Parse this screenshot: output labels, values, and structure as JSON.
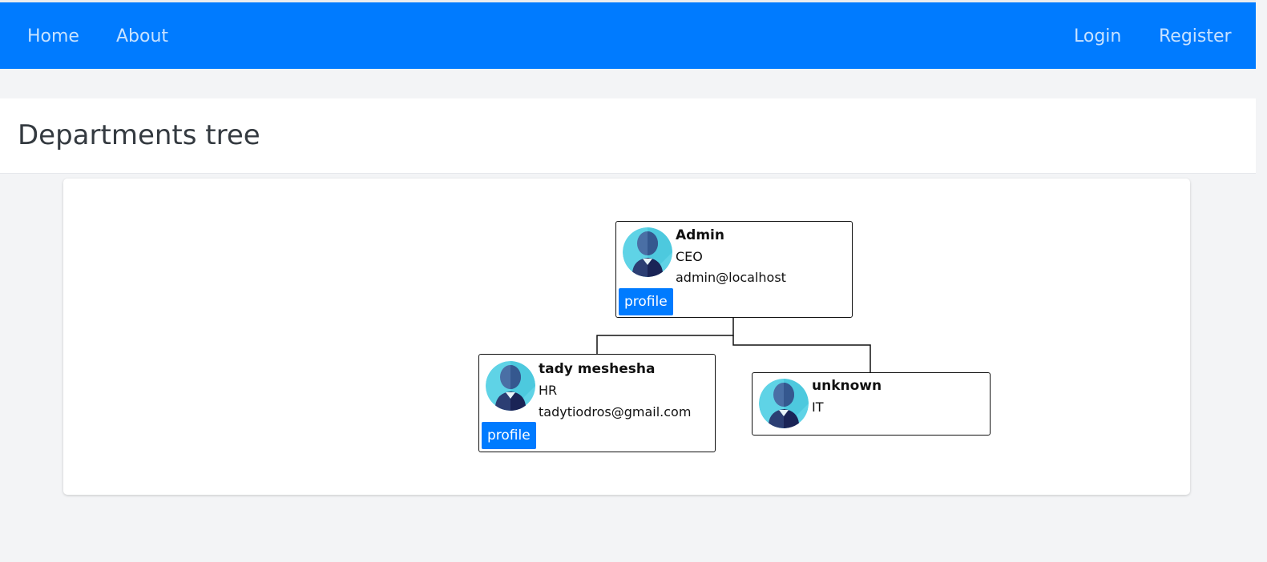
{
  "nav": {
    "home": "Home",
    "about": "About",
    "login": "Login",
    "register": "Register"
  },
  "page": {
    "title": "Departments tree"
  },
  "tree": {
    "root": {
      "name": "Admin",
      "role": "CEO",
      "email": "admin@localhost",
      "button": "profile"
    },
    "children": [
      {
        "name": "tady meshesha",
        "role": "HR",
        "email": "tadytiodros@gmail.com",
        "button": "profile"
      },
      {
        "name": "unknown",
        "role": "IT"
      }
    ]
  },
  "colors": {
    "primary": "#007bff",
    "background": "#f3f4f6",
    "avatar_bg": "#5fd3e6"
  }
}
